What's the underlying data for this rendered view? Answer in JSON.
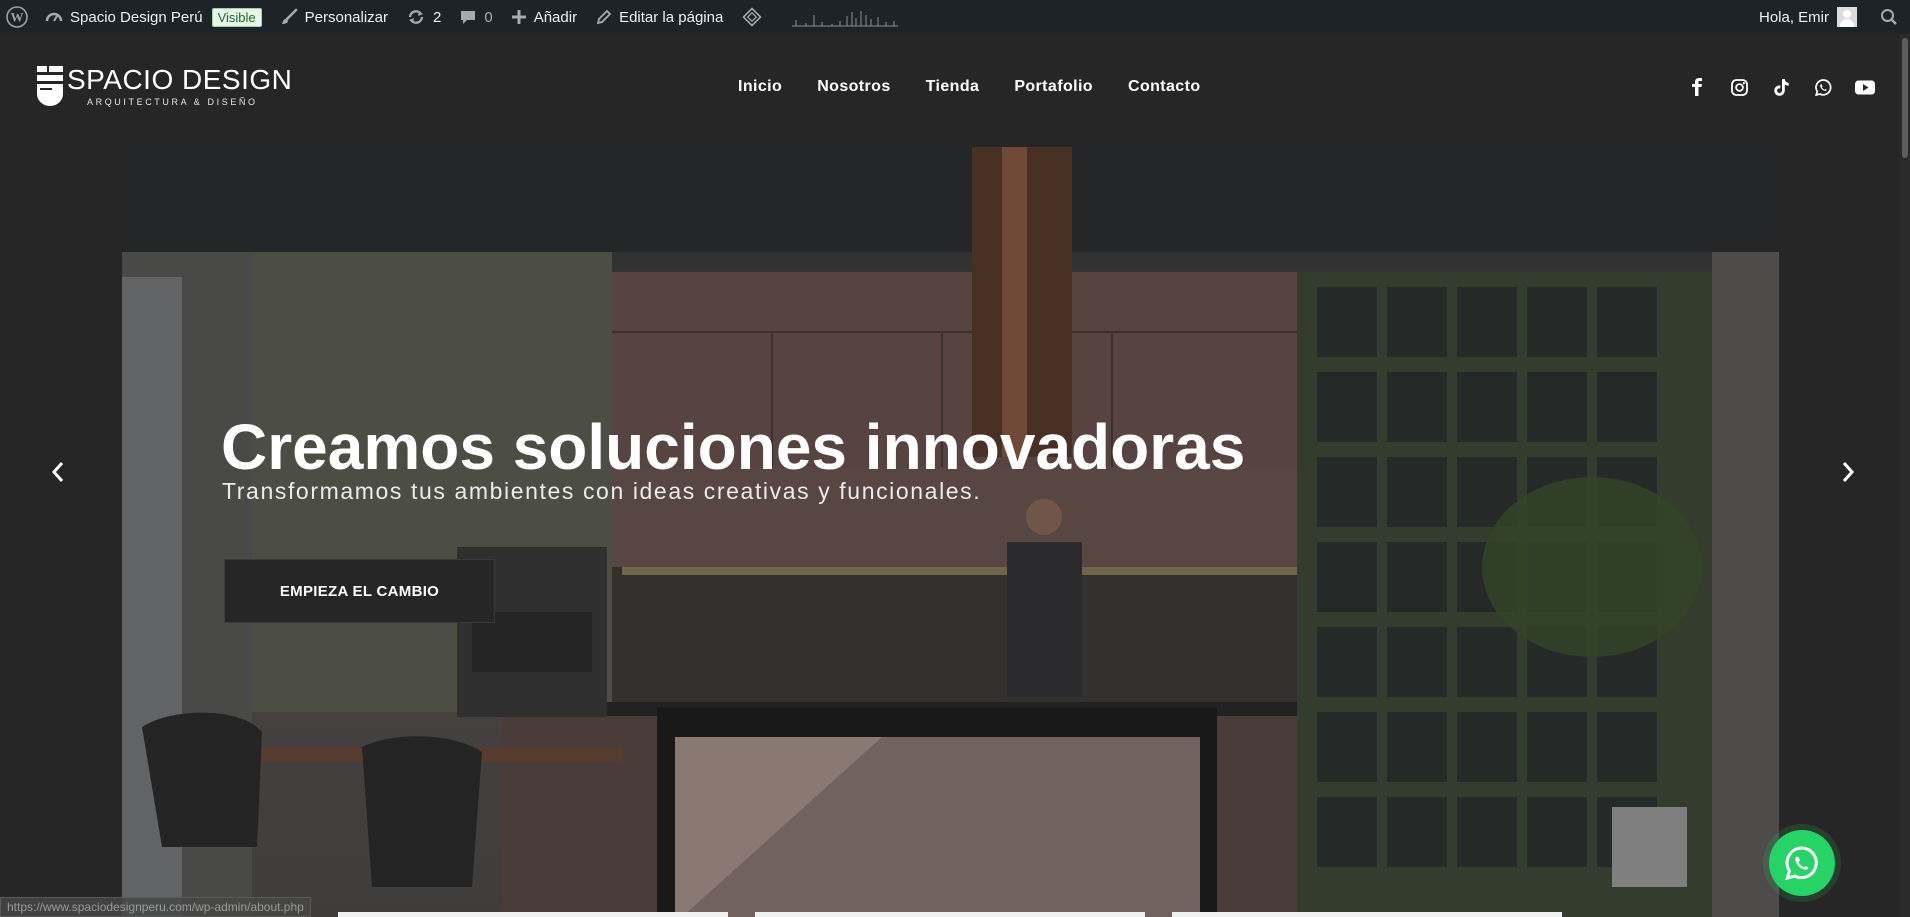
{
  "adminbar": {
    "site_name": "Spacio Design Perú",
    "visibility_badge": "Visible",
    "customize_label": "Personalizar",
    "updates_count": "2",
    "comments_count": "0",
    "add_new_label": "Añadir",
    "edit_page_label": "Editar la página",
    "greeting": "Hola, Emir"
  },
  "header": {
    "logo_title": "SPACIO DESIGN",
    "logo_subtitle": "ARQUITECTURA & DISEÑO",
    "nav": [
      {
        "label": "Inicio"
      },
      {
        "label": "Nosotros"
      },
      {
        "label": "Tienda"
      },
      {
        "label": "Portafolio"
      },
      {
        "label": "Contacto"
      }
    ],
    "social": [
      "facebook-icon",
      "instagram-icon",
      "tiktok-icon",
      "whatsapp-icon",
      "youtube-icon"
    ]
  },
  "hero": {
    "title": "Creamos soluciones innovadoras",
    "subtitle": "Transformamos tus ambientes con ideas creativas y funcionales.",
    "cta_label": "EMPIEZA EL CAMBIO"
  },
  "status_bar": {
    "url": "https://www.spaciodesignperu.com/wp-admin/about.php"
  },
  "colors": {
    "adminbar_bg": "#1d2327",
    "page_bg": "#262626",
    "whatsapp_green": "#25d366"
  }
}
